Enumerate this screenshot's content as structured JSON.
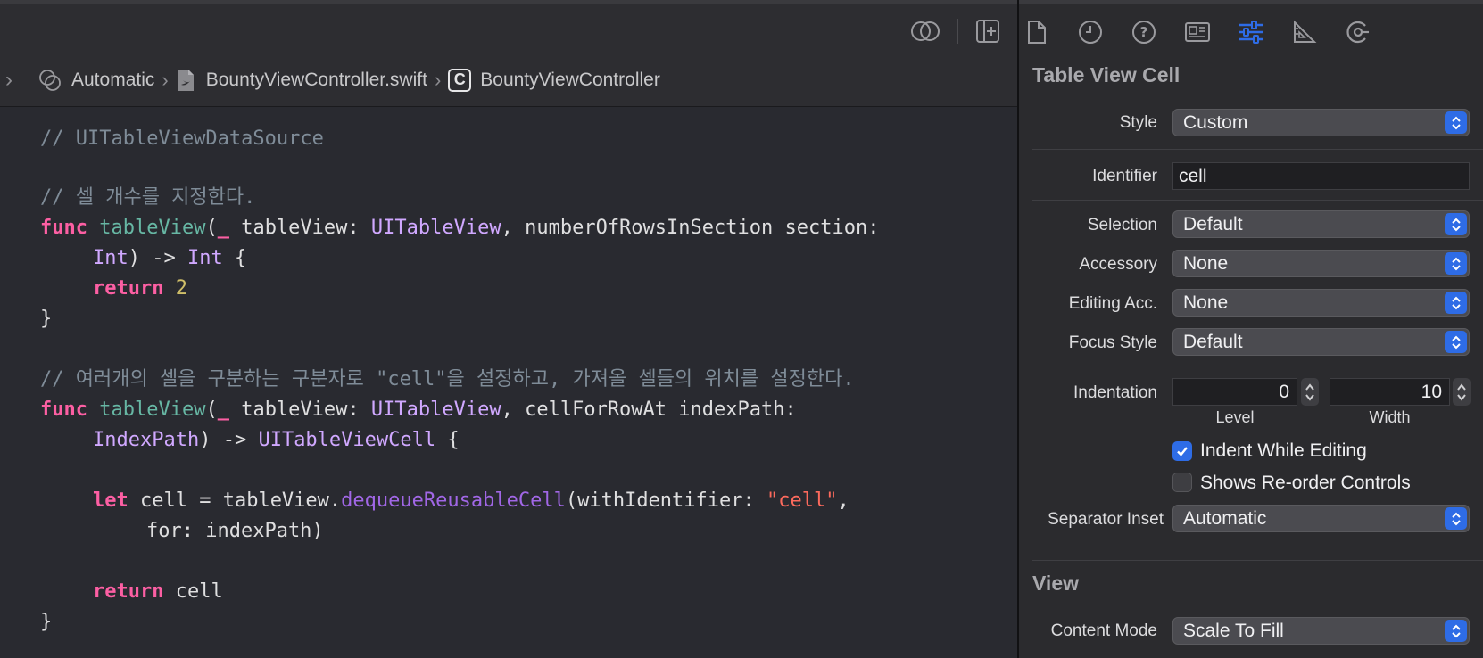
{
  "editor": {
    "jumpbar": {
      "mode": "Automatic",
      "file": "BountyViewController.swift",
      "symbol": "BountyViewController"
    },
    "code": [
      {
        "tokens": [
          {
            "t": "// UITableViewDataSource",
            "c": "comment"
          }
        ]
      },
      {
        "tokens": []
      },
      {
        "tokens": [
          {
            "t": "// 셀 개수를 지정한다.",
            "c": "comment"
          }
        ]
      },
      {
        "tokens": [
          {
            "t": "func",
            "c": "kw"
          },
          {
            "t": " ",
            "c": "plain"
          },
          {
            "t": "tableView",
            "c": "fn"
          },
          {
            "t": "(",
            "c": "plain"
          },
          {
            "t": "_",
            "c": "kw"
          },
          {
            "t": " tableView: ",
            "c": "plain"
          },
          {
            "t": "UITableView",
            "c": "type"
          },
          {
            "t": ", numberOfRowsInSection section:",
            "c": "plain"
          }
        ]
      },
      {
        "indent": 1,
        "tokens": [
          {
            "t": "Int",
            "c": "type"
          },
          {
            "t": ") -> ",
            "c": "plain"
          },
          {
            "t": "Int",
            "c": "type"
          },
          {
            "t": " {",
            "c": "plain"
          }
        ]
      },
      {
        "indent": 1,
        "tokens": [
          {
            "t": "return",
            "c": "kw"
          },
          {
            "t": " ",
            "c": "plain"
          },
          {
            "t": "2",
            "c": "num"
          }
        ]
      },
      {
        "tokens": [
          {
            "t": "}",
            "c": "plain"
          }
        ]
      },
      {
        "tokens": []
      },
      {
        "tokens": [
          {
            "t": "// 여러개의 셀을 구분하는 구분자로 \"cell\"을 설정하고, 가져올 셀들의 위치를 설정한다.",
            "c": "comment"
          }
        ]
      },
      {
        "tokens": [
          {
            "t": "func",
            "c": "kw"
          },
          {
            "t": " ",
            "c": "plain"
          },
          {
            "t": "tableView",
            "c": "fn"
          },
          {
            "t": "(",
            "c": "plain"
          },
          {
            "t": "_",
            "c": "kw"
          },
          {
            "t": " tableView: ",
            "c": "plain"
          },
          {
            "t": "UITableView",
            "c": "type"
          },
          {
            "t": ", cellForRowAt indexPath:",
            "c": "plain"
          }
        ]
      },
      {
        "indent": 1,
        "tokens": [
          {
            "t": "IndexPath",
            "c": "type"
          },
          {
            "t": ") -> ",
            "c": "plain"
          },
          {
            "t": "UITableViewCell",
            "c": "type"
          },
          {
            "t": " {",
            "c": "plain"
          }
        ]
      },
      {
        "tokens": []
      },
      {
        "indent": 1,
        "tokens": [
          {
            "t": "let",
            "c": "kw"
          },
          {
            "t": " cell = tableView.",
            "c": "plain"
          },
          {
            "t": "dequeueReusableCell",
            "c": "method"
          },
          {
            "t": "(withIdentifier: ",
            "c": "plain"
          },
          {
            "t": "\"cell\"",
            "c": "str"
          },
          {
            "t": ",",
            "c": "plain"
          }
        ]
      },
      {
        "indent": 2,
        "tokens": [
          {
            "t": "for: indexPath)",
            "c": "plain"
          }
        ]
      },
      {
        "tokens": []
      },
      {
        "indent": 1,
        "tokens": [
          {
            "t": "return",
            "c": "kw"
          },
          {
            "t": " cell",
            "c": "plain"
          }
        ]
      },
      {
        "tokens": [
          {
            "t": "}",
            "c": "plain"
          }
        ]
      }
    ]
  },
  "inspector": {
    "section_cell": "Table View Cell",
    "style_label": "Style",
    "style_value": "Custom",
    "identifier_label": "Identifier",
    "identifier_value": "cell",
    "selection_label": "Selection",
    "selection_value": "Default",
    "accessory_label": "Accessory",
    "accessory_value": "None",
    "editing_acc_label": "Editing Acc.",
    "editing_acc_value": "None",
    "focus_style_label": "Focus Style",
    "focus_style_value": "Default",
    "indentation_label": "Indentation",
    "indentation_level": "0",
    "indentation_width": "10",
    "level_label": "Level",
    "width_label": "Width",
    "indent_while_editing": "Indent While Editing",
    "indent_while_editing_checked": true,
    "shows_reorder": "Shows Re-order Controls",
    "shows_reorder_checked": false,
    "separator_inset_label": "Separator Inset",
    "separator_inset_value": "Automatic",
    "section_view": "View",
    "content_mode_label": "Content Mode",
    "content_mode_value": "Scale To Fill",
    "tabs": [
      "file-inspector-icon",
      "history-inspector-icon",
      "quick-help-icon",
      "identity-inspector-icon",
      "attributes-inspector-icon",
      "size-inspector-icon",
      "connections-inspector-icon"
    ],
    "accent": "#2e6ce6"
  }
}
